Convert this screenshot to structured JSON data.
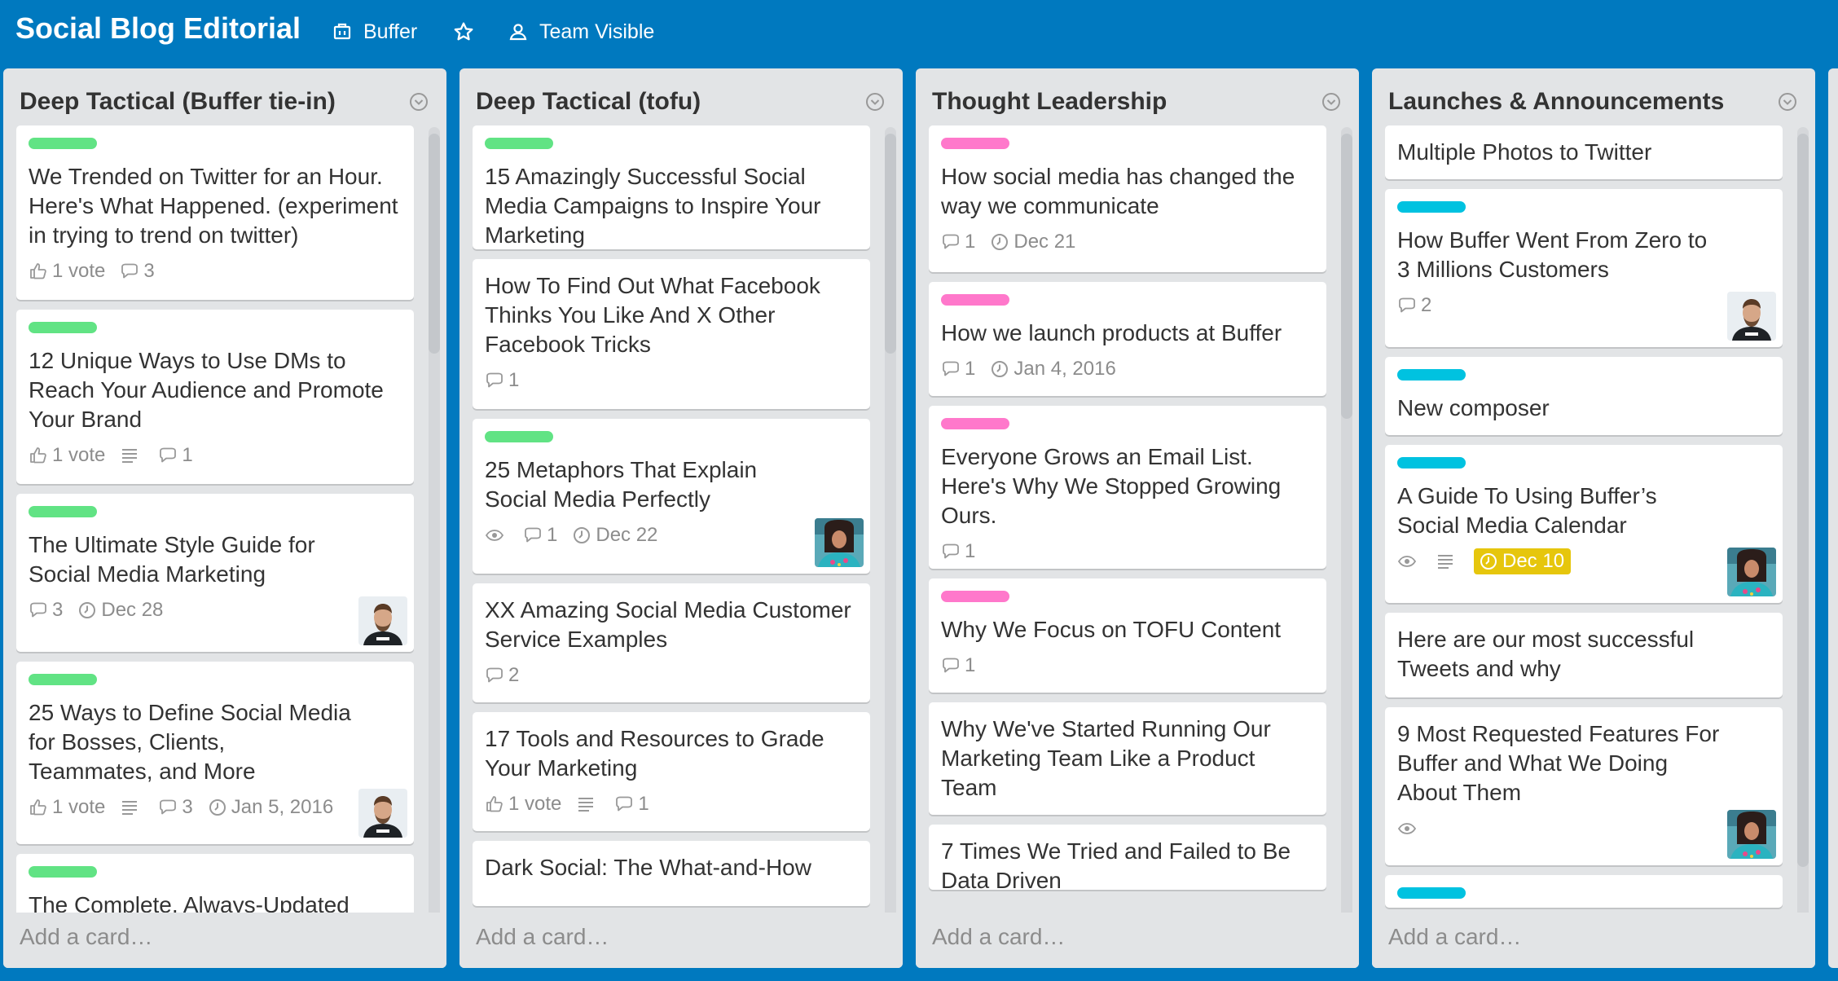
{
  "header": {
    "board_title": "Social Blog Editorial",
    "team_label": "Buffer",
    "visibility_label": "Team Visible",
    "star_icon": "star-icon"
  },
  "colors": {
    "board_bg": "#0079bf",
    "list_bg": "#e2e4e6",
    "label_green": "#61e384",
    "label_pink": "#ff78cb",
    "label_blue": "#00c2e0",
    "due_today": "#e6c60d"
  },
  "add_card_label": "Add a card…",
  "lists": [
    {
      "title": "Deep Tactical (Buffer tie-in)",
      "cards": [
        {
          "title": "We Trended on Twitter for an Hour. Here's What Happened. (experiment in trying to trend on twitter)",
          "label": "green",
          "votes": "1 vote",
          "comments": "3"
        },
        {
          "title": "12 Unique Ways to Use DMs to Reach Your Audience and Promote Your Brand",
          "label": "green",
          "votes": "1 vote",
          "description": true,
          "comments": "1"
        },
        {
          "title": "The Ultimate Style Guide for Social Media Marketing",
          "label": "green",
          "comments": "3",
          "due": "Dec 28",
          "avatar": "man"
        },
        {
          "title": "25 Ways to Define Social Media for Bosses, Clients, Teammates, and More",
          "label": "green",
          "votes": "1 vote",
          "description": true,
          "comments": "3",
          "due": "Jan 5, 2016",
          "avatar": "man"
        },
        {
          "title": "The Complete, Always-Updated",
          "label": "green"
        }
      ]
    },
    {
      "title": "Deep Tactical (tofu)",
      "cards": [
        {
          "title": "15 Amazingly Successful Social Media Campaigns to Inspire Your Marketing",
          "label": "green"
        },
        {
          "title": "How To Find Out What Facebook Thinks You Like And X Other Facebook Tricks",
          "comments": "1"
        },
        {
          "title": "25 Metaphors That Explain Social Media Perfectly",
          "label": "green",
          "watch": true,
          "comments": "1",
          "due": "Dec 22",
          "avatar": "woman"
        },
        {
          "title": "XX Amazing Social Media Customer Service Examples",
          "comments": "2"
        },
        {
          "title": "17 Tools and Resources to Grade Your Marketing",
          "votes": "1 vote",
          "description": true,
          "comments": "1"
        },
        {
          "title": "Dark Social: The What-and-How"
        }
      ]
    },
    {
      "title": "Thought Leadership",
      "cards": [
        {
          "title": "How social media has changed the way we communicate",
          "label": "pink",
          "comments": "1",
          "due": "Dec 21"
        },
        {
          "title": "How we launch products at Buffer",
          "label": "pink",
          "comments": "1",
          "due": "Jan 4, 2016"
        },
        {
          "title": "Everyone Grows an Email List. Here's Why We Stopped Growing Ours.",
          "label": "pink",
          "comments": "1"
        },
        {
          "title": "Why We Focus on TOFU Content",
          "label": "pink",
          "comments": "1"
        },
        {
          "title": "Why We've Started Running Our Marketing Team Like a Product Team"
        },
        {
          "title": "7 Times We Tried and Failed to Be Data Driven"
        }
      ]
    },
    {
      "title": "Launches & Announcements",
      "cards": [
        {
          "title": "Multiple Photos to Twitter"
        },
        {
          "title": "How Buffer Went From Zero to 3 Millions Customers",
          "label": "blue",
          "comments": "2",
          "avatar": "man"
        },
        {
          "title": "New composer",
          "label": "blue"
        },
        {
          "title": "A Guide To Using Buffer’s Social Media Calendar",
          "label": "blue",
          "watch": true,
          "description": true,
          "due": "Dec 10",
          "due_today": true,
          "avatar": "woman"
        },
        {
          "title": "Here are our most successful Tweets and why"
        },
        {
          "title": "9 Most Requested Features For Buffer and What We Doing About Them",
          "watch": true,
          "avatar": "woman"
        },
        {
          "title": "",
          "label": "blue"
        }
      ]
    }
  ]
}
